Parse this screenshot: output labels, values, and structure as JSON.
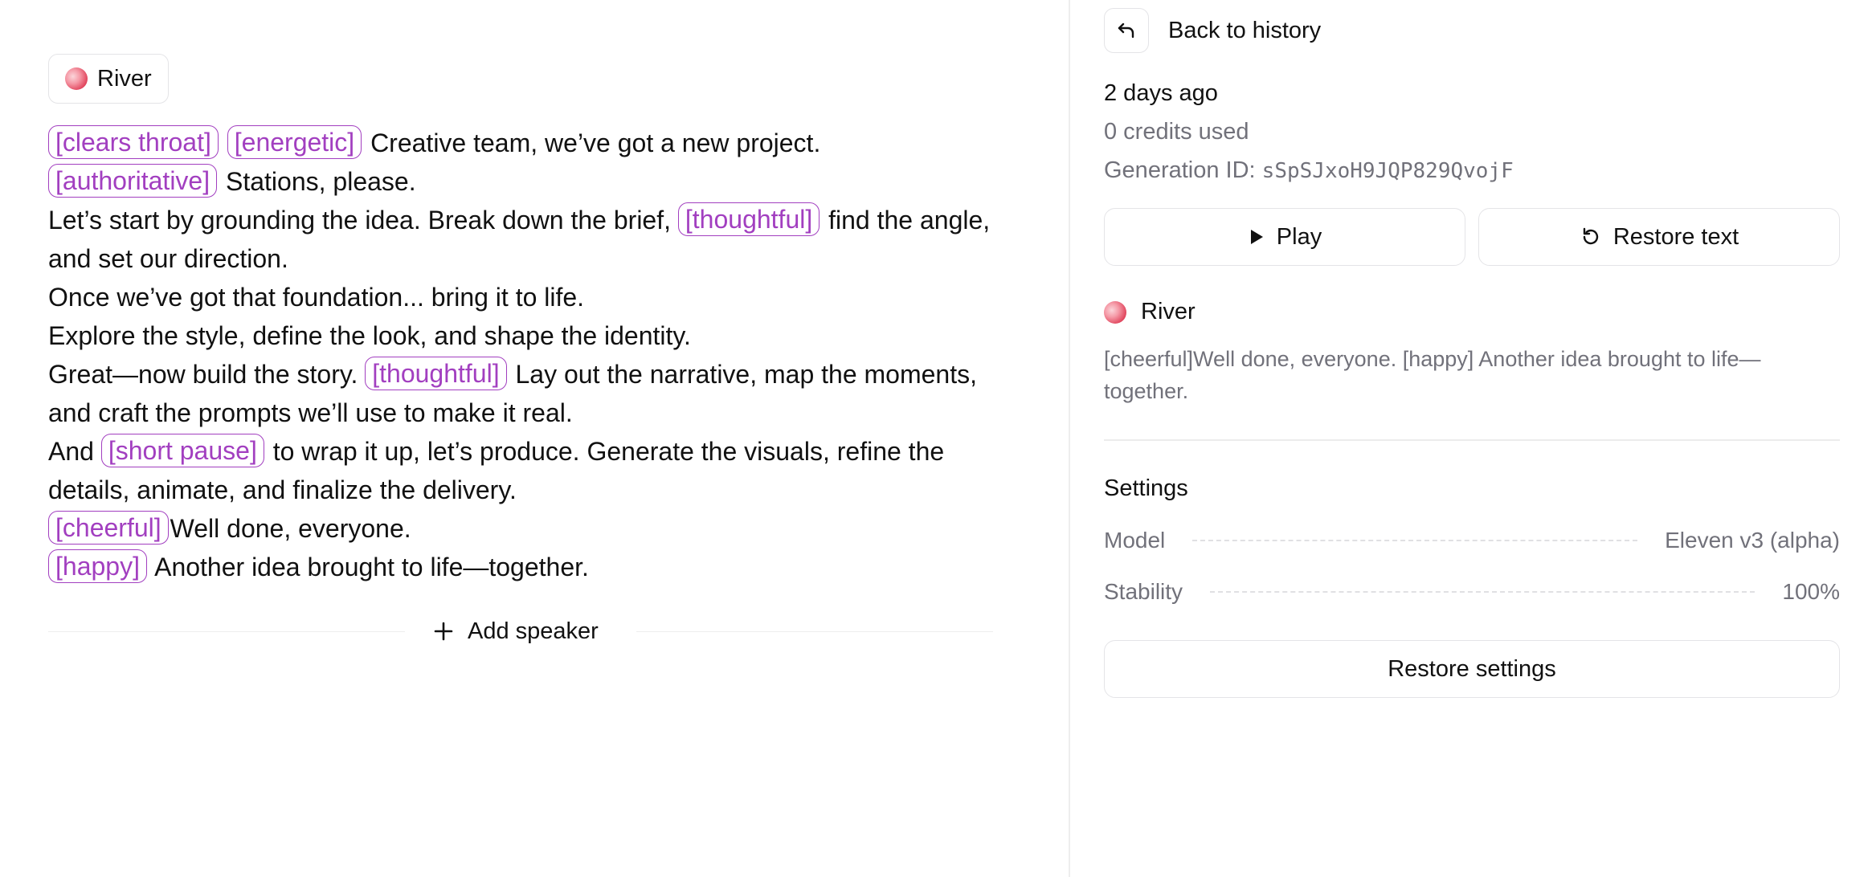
{
  "speaker": {
    "name": "River"
  },
  "script": {
    "lines": [
      [
        {
          "type": "tag",
          "text": "[clears throat]"
        },
        {
          "type": "text",
          "text": " "
        },
        {
          "type": "tag",
          "text": "[energetic]"
        },
        {
          "type": "text",
          "text": " Creative team, we’ve got a new project."
        }
      ],
      [
        {
          "type": "tag",
          "text": "[authoritative]"
        },
        {
          "type": "text",
          "text": " Stations, please."
        }
      ],
      [
        {
          "type": "text",
          "text": "Let’s start by grounding the idea. Break down the brief, "
        },
        {
          "type": "tag",
          "text": "[thoughtful]"
        },
        {
          "type": "text",
          "text": " find the angle, and set our direction."
        }
      ],
      [
        {
          "type": "text",
          "text": "Once we’ve got that foundation... bring it to life."
        }
      ],
      [
        {
          "type": "text",
          "text": "Explore the style, define the look, and shape the identity."
        }
      ],
      [
        {
          "type": "text",
          "text": "Great—now build the story. "
        },
        {
          "type": "tag",
          "text": "[thoughtful]"
        },
        {
          "type": "text",
          "text": " Lay out the narrative, map the moments, and craft the prompts we’ll use to make it real."
        }
      ],
      [
        {
          "type": "text",
          "text": "And "
        },
        {
          "type": "tag",
          "text": "[short pause]"
        },
        {
          "type": "text",
          "text": " to wrap it up, let’s produce. Generate the visuals, refine the details, animate, and finalize the delivery."
        }
      ],
      [
        {
          "type": "tag",
          "text": "[cheerful]"
        },
        {
          "type": "text",
          "text": "Well done, everyone."
        }
      ],
      [
        {
          "type": "tag",
          "text": "[happy]"
        },
        {
          "type": "text",
          "text": " Another idea brought to life—together."
        }
      ]
    ]
  },
  "editor": {
    "add_speaker_label": "Add speaker"
  },
  "details": {
    "back_label": "Back to history",
    "time_ago": "2 days ago",
    "credits_used": "0 credits used",
    "generation_id_label": "Generation ID:",
    "generation_id_value": "sSpSJxoH9JQP829QvojF",
    "play_label": "Play",
    "restore_text_label": "Restore text",
    "voice_name": "River",
    "voice_text": "[cheerful]Well done, everyone. [happy] Another idea brought to life—together.",
    "settings_title": "Settings",
    "settings": [
      {
        "label": "Model",
        "value": "Eleven v3 (alpha)"
      },
      {
        "label": "Stability",
        "value": "100%"
      }
    ],
    "restore_settings_label": "Restore settings"
  },
  "colors": {
    "tag_accent": "#a23fc0",
    "muted_text": "#71717a",
    "border": "#e4e4e7"
  },
  "icons": {
    "back": "undo-arrow-icon",
    "play": "play-icon",
    "restore": "rotate-ccw-icon",
    "add": "plus-icon",
    "avatar": "speaker-avatar"
  }
}
